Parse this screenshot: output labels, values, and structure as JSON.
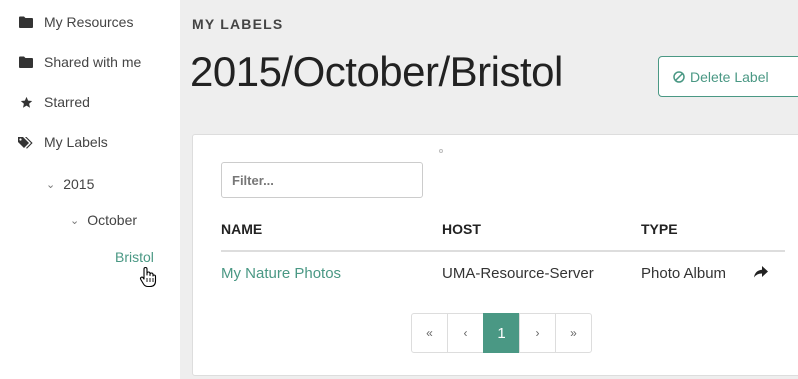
{
  "sidebar": {
    "items": [
      {
        "label": "My Resources",
        "icon": "folder-icon"
      },
      {
        "label": "Shared with me",
        "icon": "folder-icon"
      },
      {
        "label": "Starred",
        "icon": "star-icon"
      },
      {
        "label": "My Labels",
        "icon": "tags-icon"
      }
    ],
    "tree": {
      "year": "2015",
      "month": "October",
      "active": "Bristol"
    }
  },
  "main": {
    "section_label": "MY LABELS",
    "title": "2015/October/Bristol",
    "delete_label": "Delete Label",
    "filter_placeholder": "Filter...",
    "table": {
      "headers": [
        "NAME",
        "HOST",
        "TYPE"
      ],
      "rows": [
        {
          "name": "My Nature Photos",
          "host": "UMA-Resource-Server",
          "type": "Photo Album",
          "action_icon": "share-icon"
        }
      ]
    },
    "pagination": [
      "«",
      "‹",
      "1",
      "›",
      "»"
    ],
    "current_page": "1"
  },
  "colors": {
    "accent": "#4a9884",
    "panel_bg": "#eeeeee"
  }
}
